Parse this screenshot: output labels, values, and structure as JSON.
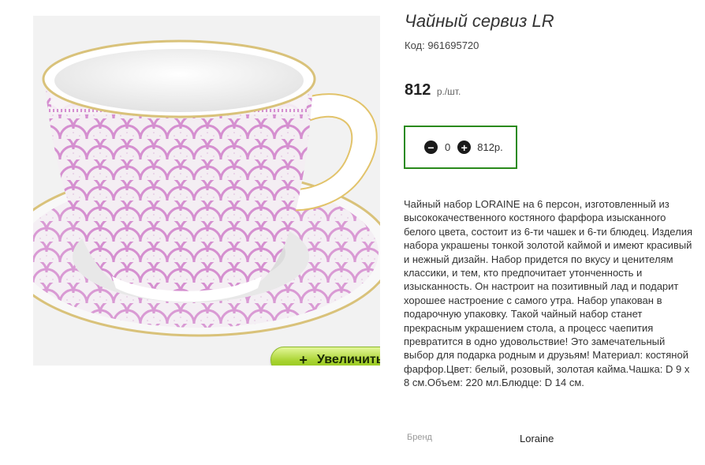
{
  "product": {
    "title": "Чайный сервиз LR",
    "sku": "Код: 961695720",
    "price": {
      "amount": "812",
      "unit": "р./шт."
    },
    "quantity": {
      "minus_icon": "minus-circle-icon",
      "value": "0",
      "plus_icon": "plus-circle-icon",
      "total": "812р."
    },
    "zoom_button": {
      "icon": "+",
      "label": "Увеличить"
    },
    "image": {
      "alt": "tea-cup-with-saucer"
    },
    "description": "Чайный набор LORAINE на 6 персон, изготовленный из высококачественного костяного фарфора изысканного белого цвета, состоит из 6-ти чашек и 6-ти блюдец. Изделия набора украшены тонкой золотой каймой и имеют красивый и нежный дизайн. Набор придется по вкусу и ценителям классики, и тем, кто предпочитает утонченность и изысканность. Он настроит на позитивный лад и подарит хорошее настроение с самого утра. Набор упакован в подарочную упаковку. Такой чайный набор станет прекрасным украшением стола, а процесс чаепития превратится в одно удовольствие! Это замечательный выбор для подарка родным и друзьям! Материал: костяной фарфор.Цвет: белый, розовый, золотая кайма.Чашка: D 9 x 8 см.Объем: 220 мл.Блюдце: D 14 см.",
    "brand": {
      "label": "Бренд",
      "value": "Loraine"
    }
  },
  "colors": {
    "accent_border": "#2a8a1c",
    "button_green": "#a6d22d",
    "pattern_pink": "#d58fd0"
  }
}
